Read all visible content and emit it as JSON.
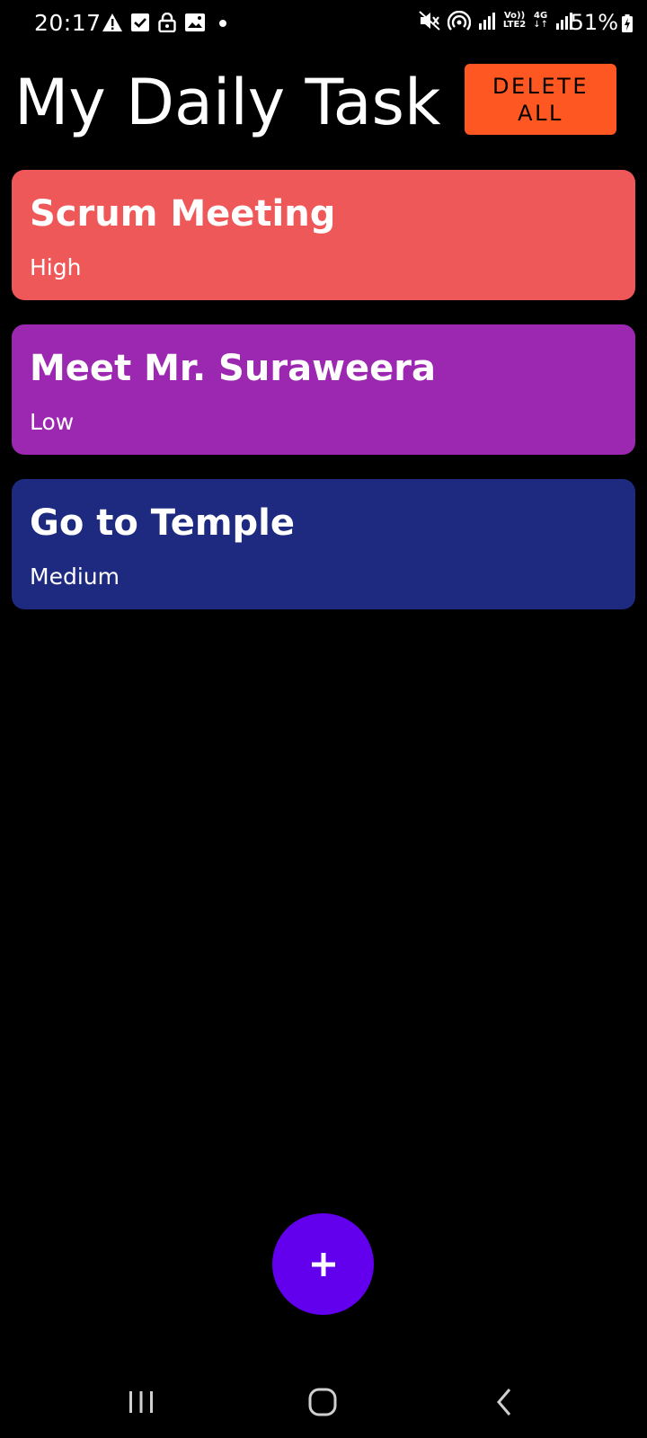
{
  "status_bar": {
    "time": "20:17",
    "battery_percent": "51%",
    "left_icons": [
      "warning-icon",
      "checkbox-icon",
      "lock-icon",
      "image-icon",
      "dot-icon"
    ],
    "right_icons": [
      "mute-icon",
      "hotspot-icon",
      "signal-icon",
      "volte-icon",
      "4g-icon",
      "signal-icon",
      "battery-charging-icon"
    ],
    "volte_label_top": "Vo))",
    "volte_label_bottom": "LTE2",
    "network_label": "4G"
  },
  "header": {
    "title": "My Daily Task",
    "delete_all_label": "DELETE\nALL"
  },
  "tasks": [
    {
      "title": "Scrum Meeting",
      "priority": "High",
      "color": "#ef5859"
    },
    {
      "title": "Meet Mr. Suraweera",
      "priority": "Low",
      "color": "#9c27b0"
    },
    {
      "title": "Go to Temple",
      "priority": "Medium",
      "color": "#1d2a80"
    }
  ],
  "fab": {
    "icon": "plus-icon",
    "color": "#6200ee"
  },
  "nav_bar": {
    "icons": [
      "recents-icon",
      "home-icon",
      "back-icon"
    ]
  },
  "colors": {
    "background": "#000000",
    "delete_button": "#ff5722"
  }
}
